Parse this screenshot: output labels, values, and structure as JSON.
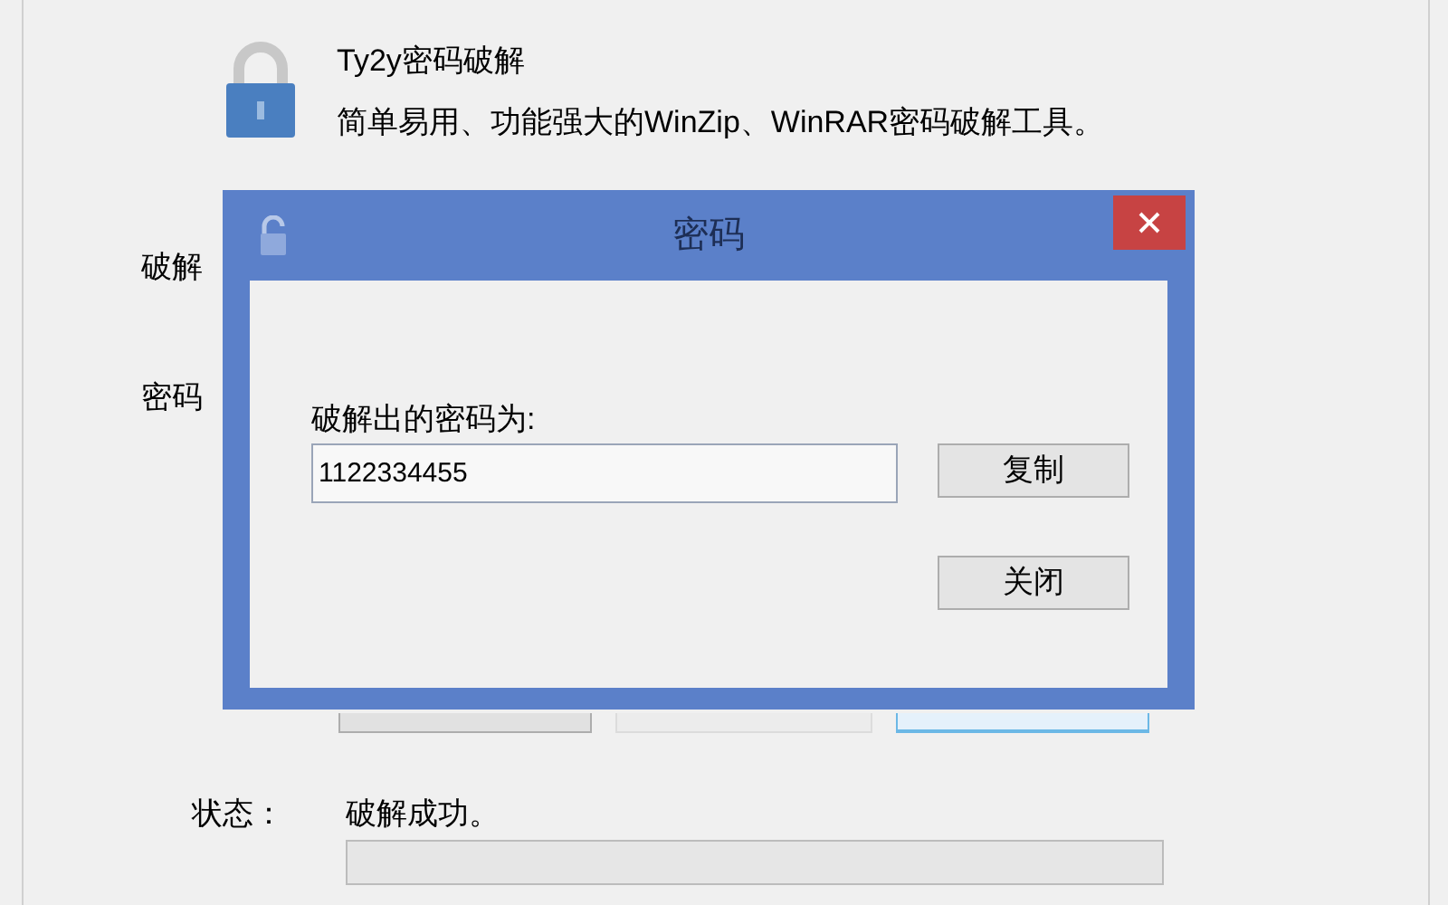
{
  "app": {
    "title": "Ty2y密码破解",
    "description": "简单易用、功能强大的WinZip、WinRAR密码破解工具。"
  },
  "form_labels": [
    "破解",
    "密码"
  ],
  "status": {
    "label": "状态：",
    "value": "破解成功。",
    "level": 0
  },
  "dialog": {
    "title": "密码",
    "label": "破解出的密码为:",
    "value": "1122334455",
    "buttons": [
      "复制",
      "关闭"
    ]
  }
}
